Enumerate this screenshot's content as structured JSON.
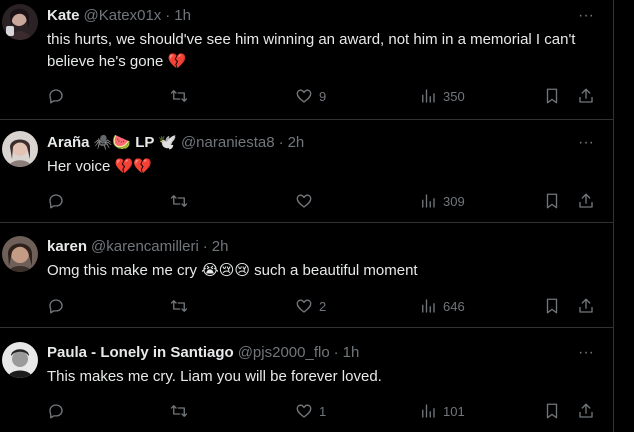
{
  "tweets": [
    {
      "name": "Kate",
      "handle": "@Katex01x",
      "dot": "·",
      "time": "1h",
      "text": "this hurts, we should've see him winning an award, not him in a memorial I can't believe he's gone 💔",
      "likes": "9",
      "views": "350",
      "avatar_color": "#4a3a3a"
    },
    {
      "name": "Araña 🕷️🍉 LP 🕊️",
      "handle": "@naraniesta8",
      "dot": "·",
      "time": "2h",
      "text": "Her voice 💔💔",
      "likes": "",
      "views": "309",
      "avatar_color": "#7a6a66"
    },
    {
      "name": "karen",
      "handle": "@karencamilleri",
      "dot": "·",
      "time": "2h",
      "text": "Omg this make me cry 😭😢😢 such a beautiful moment",
      "likes": "2",
      "views": "646",
      "avatar_color": "#5a4a45"
    },
    {
      "name": "Paula - Lonely in Santiago",
      "handle": "@pjs2000_flo",
      "dot": "·",
      "time": "1h",
      "text": "This makes me cry. Liam you will be forever loved.",
      "likes": "1",
      "views": "101",
      "avatar_color": "#6a6a6a"
    }
  ],
  "more_label": "···"
}
